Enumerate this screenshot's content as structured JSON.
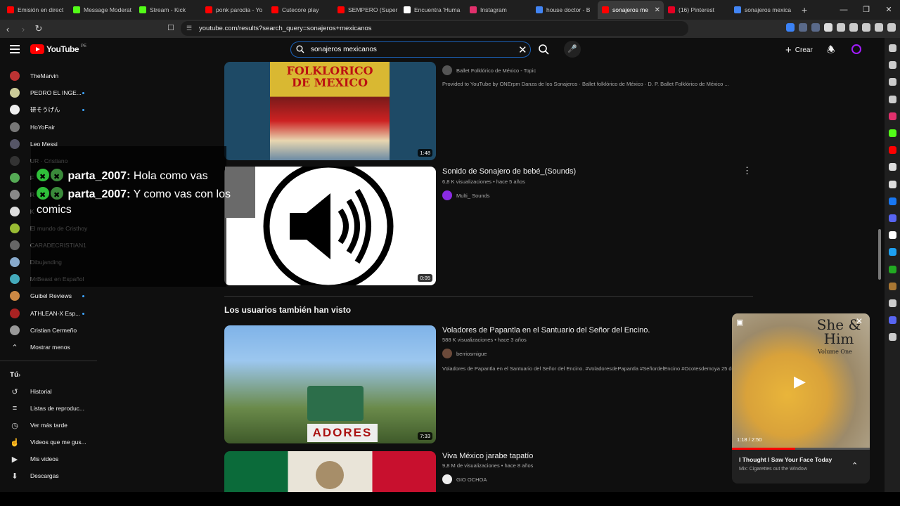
{
  "browser": {
    "tabs": [
      {
        "label": "Emisión en direct",
        "color": "#ff0000"
      },
      {
        "label": "Message Moderat",
        "color": "#53fc18"
      },
      {
        "label": "Stream - Kick",
        "color": "#53fc18"
      },
      {
        "label": "ponk parodia - Yo",
        "color": "#ff0000"
      },
      {
        "label": "Cutecore play",
        "color": "#ff0000"
      },
      {
        "label": "SEMPERO (Super",
        "color": "#ff0000"
      },
      {
        "label": "Encuentra 'Huma",
        "color": "#ffffff"
      },
      {
        "label": "Instagram",
        "color": "#e1306c"
      },
      {
        "label": "house doctor - B",
        "color": "#4285f4"
      },
      {
        "label": "sonajeros me",
        "color": "#ff0000"
      },
      {
        "label": "(16) Pinterest",
        "color": "#e60023"
      },
      {
        "label": "sonajeros mexica",
        "color": "#4285f4"
      }
    ],
    "new_tab": "+",
    "url": "youtube.com/results?search_query=sonajeros+mexicanos"
  },
  "header": {
    "logo_text": "YouTube",
    "logo_region": "PE",
    "search_value": "sonajeros mexicanos",
    "create_label": "Crear"
  },
  "sidebar": {
    "subscriptions": [
      {
        "label": "TheMarvin",
        "dot": false,
        "color": "#b33"
      },
      {
        "label": "PEDRO EL INGE...",
        "dot": true,
        "color": "#cc9"
      },
      {
        "label": "研そうげん",
        "dot": true,
        "color": "#eee"
      },
      {
        "label": "HoYoFair",
        "dot": false,
        "color": "#777"
      },
      {
        "label": "Leo Messi",
        "dot": false,
        "color": "#556"
      },
      {
        "label": "UR · Cristiano",
        "dot": false,
        "color": "#333"
      },
      {
        "label": "F",
        "dot": false,
        "color": "#5a5"
      },
      {
        "label": "R",
        "dot": false,
        "color": "#888"
      },
      {
        "label": "K",
        "dot": false,
        "color": "#ddd"
      },
      {
        "label": "El mundo de Cristhoy",
        "dot": false,
        "color": "#9b3"
      },
      {
        "label": "CARADECRISTIAN1",
        "dot": false,
        "color": "#666"
      },
      {
        "label": "Dibujanding",
        "dot": false,
        "color": "#8ac"
      },
      {
        "label": "MrBeast en Español",
        "dot": false,
        "color": "#4ab"
      },
      {
        "label": "Guibel Reviews",
        "dot": true,
        "color": "#c84"
      },
      {
        "label": "ATHLEAN-X Esp...",
        "dot": true,
        "color": "#a22"
      },
      {
        "label": "Cristian Cermeño",
        "dot": false,
        "color": "#999"
      }
    ],
    "show_less": "Mostrar menos",
    "you_heading": "Tú",
    "you_items": [
      "Historial",
      "Listas de reproduc...",
      "Ver más tarde",
      "Videos que me gus...",
      "Mis videos",
      "Descargas"
    ]
  },
  "chat": {
    "messages": [
      {
        "user": "parta_2007:",
        "text": "Hola como vas"
      },
      {
        "user": "parta_2007:",
        "text": "Y como vas con los comics"
      }
    ]
  },
  "results": [
    {
      "title": "",
      "channel": "Ballet Folklórico de México - Topic",
      "description": "Provided to YouTube by ONErpm Danza de los Sonajeros · Ballet folklórico de México · D. P. Ballet Folklórico de México ...",
      "duration": "1:48",
      "thumb_text": "FOLKLORICO DE MEXICO"
    },
    {
      "title": "Sonido de Sonajero de bebé_(Sounds)",
      "meta": "6,8 K visualizaciones • hace 5 años",
      "channel": "Multi_ Sounds",
      "duration": "0:05"
    }
  ],
  "section_title": "Los usuarios también han visto",
  "related": [
    {
      "title": "Voladores de Papantla en el Santuario del Señor del Encino.",
      "meta": "588 K visualizaciones • hace 3 años",
      "channel": "berriosmigue",
      "description": "Voladores de Papantla en el Santuario del Señor del Encino. #VoladoresdePapantla #SeñordelEncino #Ocotesdemoya 25 de",
      "duration": "7:33",
      "thumb_text": "ADORES"
    },
    {
      "title": "Viva México jarabe tapatío",
      "meta": "9,8 M de visualizaciones • hace 8 años",
      "channel": "GIO OCHOA"
    }
  ],
  "miniplayer": {
    "art_text": "She & Him",
    "art_sub": "Volume One",
    "time": "1:18 / 2:50",
    "progress": 0.46,
    "title": "I Thought I Saw Your Face Today",
    "subtitle": "Mix: Cigarettes out the Window"
  },
  "colors": {
    "accent": "#ff0000",
    "link": "#3ea6ff",
    "kick": "#53fc18"
  }
}
